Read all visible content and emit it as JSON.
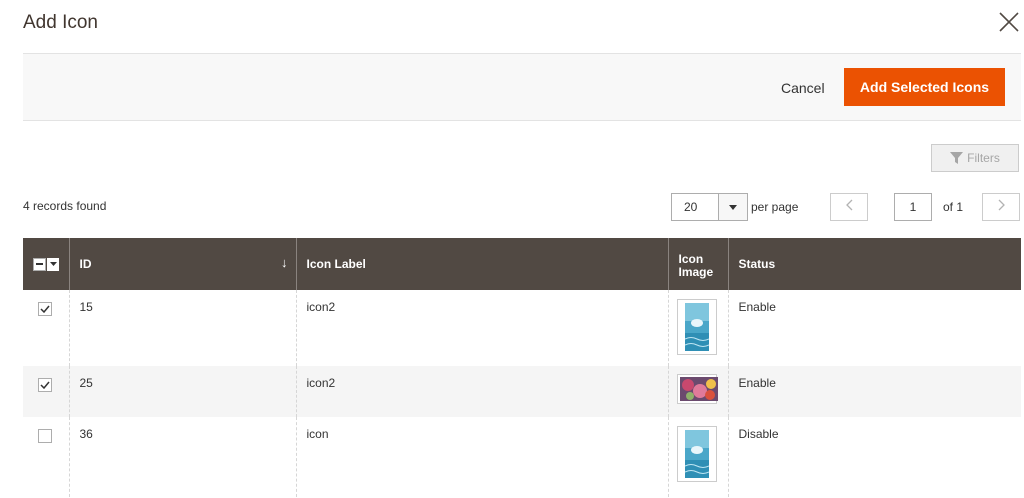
{
  "modal": {
    "title": "Add Icon"
  },
  "actions": {
    "cancel_label": "Cancel",
    "add_label": "Add Selected Icons"
  },
  "toolbar": {
    "filters_label": "Filters",
    "records_found": "4 records found",
    "per_page_value": "20",
    "per_page_label": "per page",
    "current_page": "1",
    "page_total": "of 1"
  },
  "columns": {
    "id": "ID",
    "label": "Icon Label",
    "image": "Icon Image",
    "status": "Status"
  },
  "rows": [
    {
      "id": "15",
      "label": "icon2",
      "status": "Enable",
      "checked": true,
      "image": "water-thumbnail"
    },
    {
      "id": "25",
      "label": "icon2",
      "status": "Enable",
      "checked": true,
      "image": "flowers-thumbnail"
    },
    {
      "id": "36",
      "label": "icon",
      "status": "Disable",
      "checked": false,
      "image": "water-thumbnail"
    }
  ],
  "colors": {
    "primary_button": "#eb5202",
    "header_bg": "#514943",
    "title_text": "#41362f"
  }
}
